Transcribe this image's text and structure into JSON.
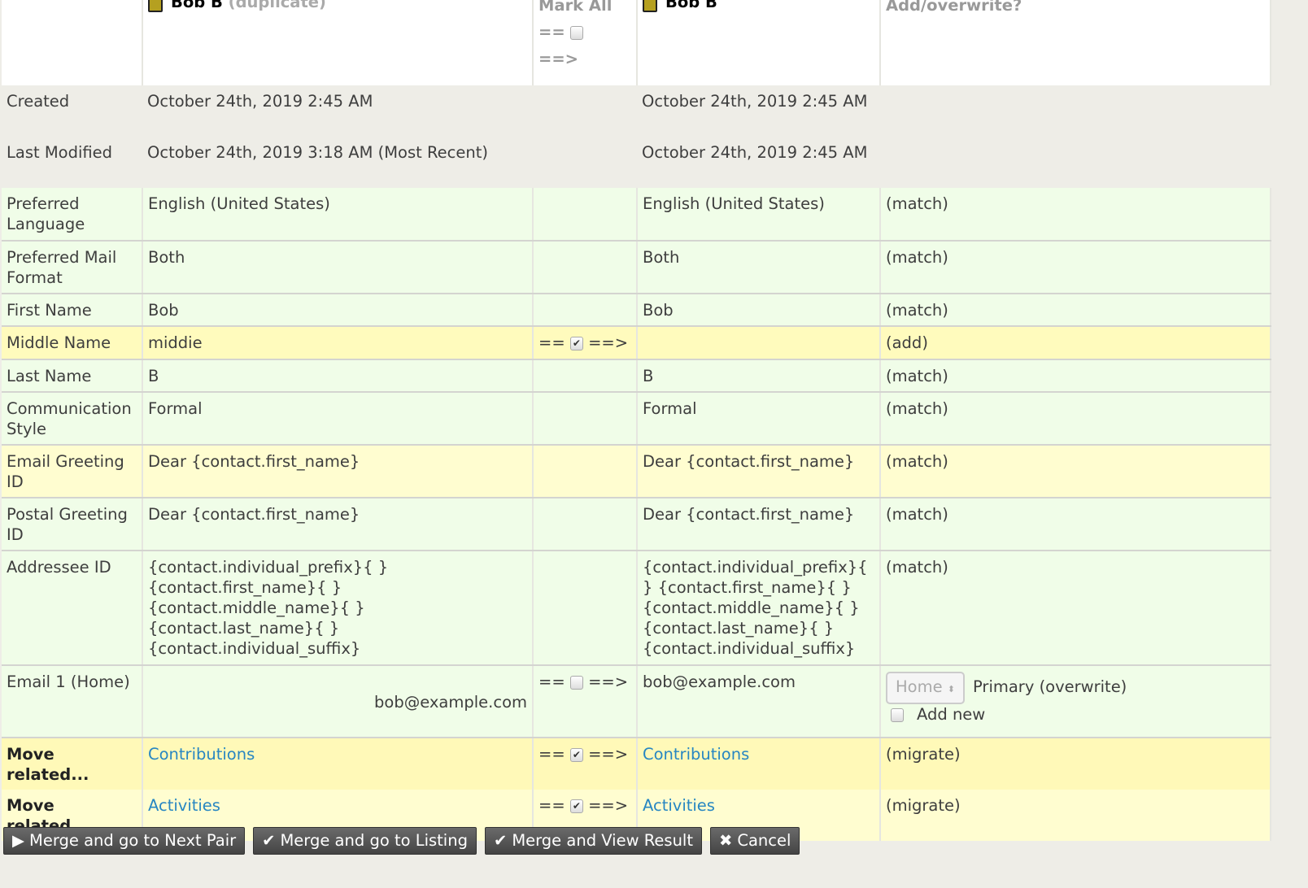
{
  "header": {
    "dup_name": "Bob B",
    "dup_suffix": "(duplicate)",
    "mark_all": "Mark All",
    "mark_left": "==",
    "mark_right": "==>",
    "main_name": "Bob B",
    "action": "Add/overwrite?"
  },
  "rows": [
    {
      "style": "gray",
      "label": "Created",
      "dup": "October 24th, 2019 2:45 AM",
      "main": "October 24th, 2019 2:45 AM",
      "action": "",
      "mark": "none"
    },
    {
      "style": "gray",
      "label": "Last Modified",
      "dup": "October 24th, 2019 3:18 AM (Most Recent)",
      "main": "October 24th, 2019 2:45 AM",
      "action": "",
      "mark": "none"
    },
    {
      "style": "green",
      "label": "Preferred Language",
      "dup": "English (United States)",
      "main": "English (United States)",
      "action": "(match)",
      "mark": "none"
    },
    {
      "style": "green",
      "label": "Preferred Mail Format",
      "dup": "Both",
      "main": "Both",
      "action": "(match)",
      "mark": "none"
    },
    {
      "style": "green",
      "label": "First Name",
      "dup": "Bob",
      "main": "Bob",
      "action": "(match)",
      "mark": "none"
    },
    {
      "style": "yellow",
      "label": "Middle Name",
      "dup": "middie",
      "main": "",
      "action": "(add)",
      "mark": "checked"
    },
    {
      "style": "green",
      "label": "Last Name",
      "dup": "B",
      "main": "B",
      "action": "(match)",
      "mark": "none"
    },
    {
      "style": "green",
      "label": "Communication Style",
      "dup": "Formal",
      "main": "Formal",
      "action": "(match)",
      "mark": "none"
    },
    {
      "style": "lyellow",
      "label": "Email Greeting ID",
      "dup": "Dear {contact.first_name}",
      "main": "Dear {contact.first_name}",
      "action": "(match)",
      "mark": "none"
    },
    {
      "style": "green",
      "label": "Postal Greeting ID",
      "dup": "Dear {contact.first_name}",
      "main": "Dear {contact.first_name}",
      "action": "(match)",
      "mark": "none"
    },
    {
      "style": "green",
      "label": "Addressee ID",
      "dup": "{contact.individual_prefix}{ } {contact.first_name}{ } {contact.middle_name}{ } {contact.last_name}{ } {contact.individual_suffix}",
      "main": "{contact.individual_prefix}{ } {contact.first_name}{ }{contact.middle_name}{ }{contact.last_name}{ } {contact.individual_suffix}",
      "action": "(match)",
      "mark": "none"
    }
  ],
  "email_row": {
    "label": "Email 1 (Home)",
    "dup": "bob@example.com",
    "main": "bob@example.com",
    "location": "Home",
    "primary": "Primary (overwrite)",
    "add_new": "Add new"
  },
  "move_rows": [
    {
      "label": "Move related...",
      "dup": "Contributions",
      "main": "Contributions",
      "action": "(migrate)"
    },
    {
      "label": "Move related...",
      "dup": "Activities",
      "main": "Activities",
      "action": "(migrate)"
    }
  ],
  "buttons": [
    {
      "icon": "play-circle",
      "label": "Merge and go to Next Pair",
      "glyph": "▶"
    },
    {
      "icon": "check",
      "label": "Merge and go to Listing",
      "glyph": "✔"
    },
    {
      "icon": "check-circle",
      "label": "Merge and View Result",
      "glyph": "✔"
    },
    {
      "icon": "close",
      "label": "Cancel",
      "glyph": "✖"
    }
  ]
}
